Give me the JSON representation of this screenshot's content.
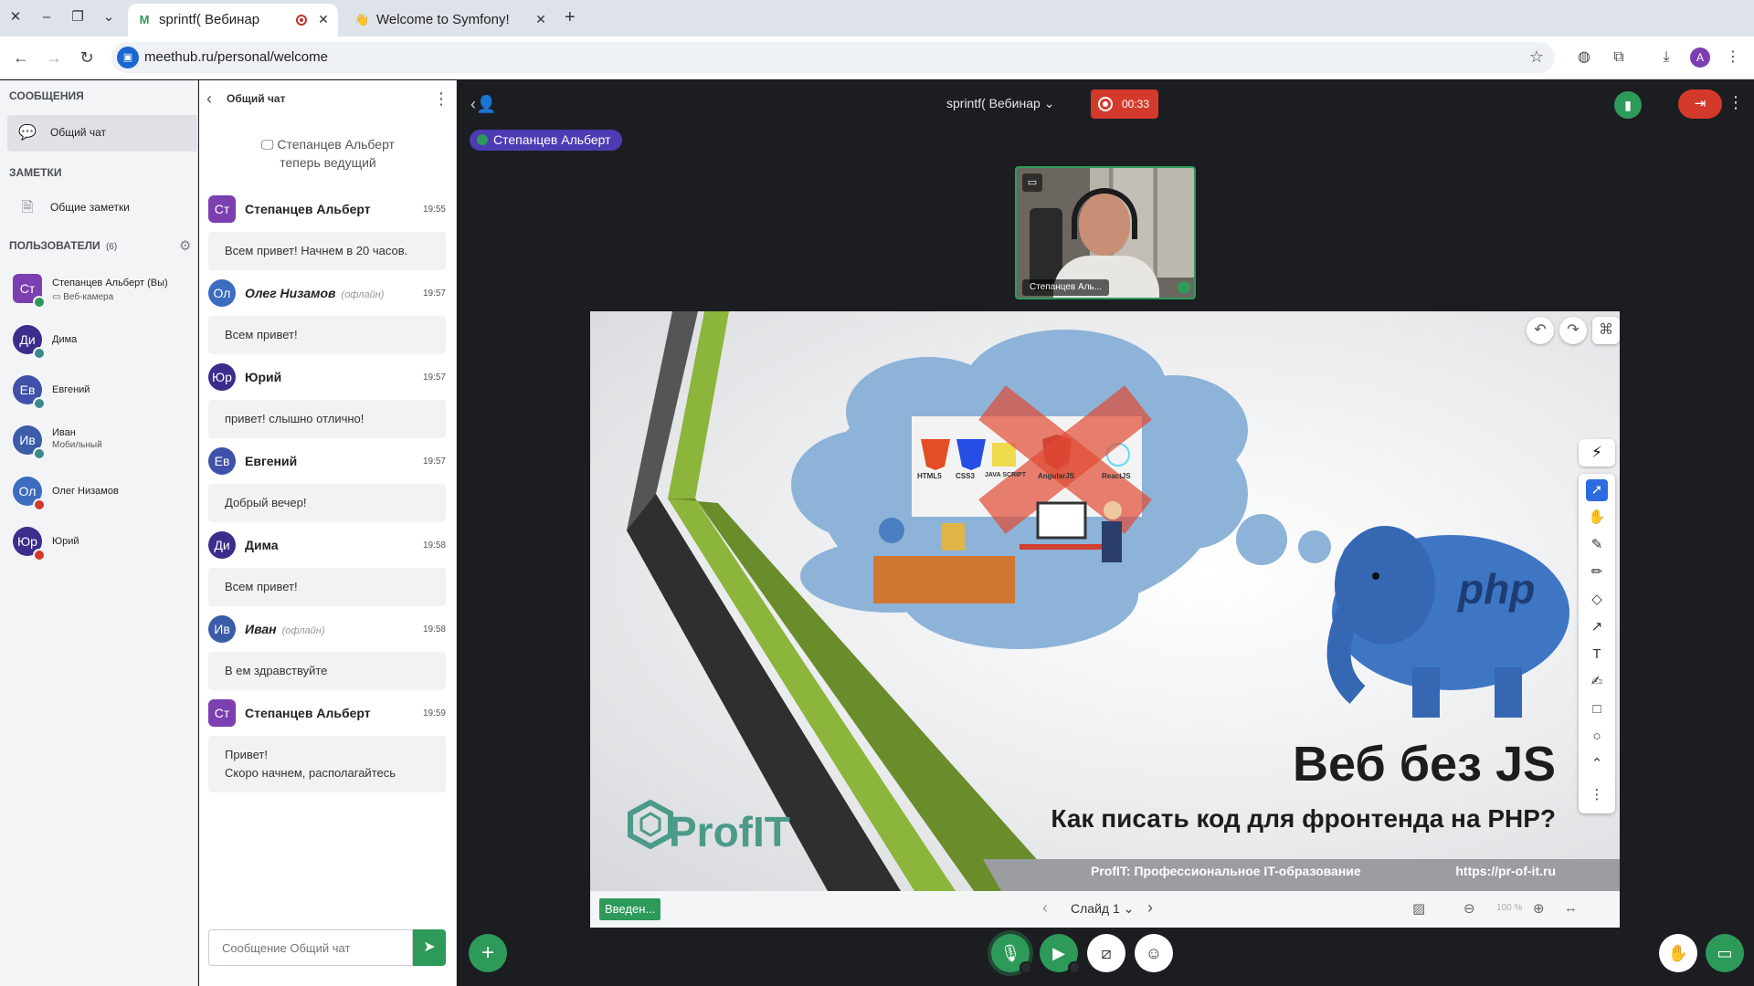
{
  "browser": {
    "tabs": [
      {
        "favicon": "M",
        "title": "sprintf( Вебинар"
      },
      {
        "favicon": "👋",
        "title": "Welcome to Symfony!"
      }
    ],
    "url": "meethub.ru/personal/welcome",
    "profile_initial": "A"
  },
  "sidebar": {
    "messages_title": "СООБЩЕНИЯ",
    "general_chat": "Общий чат",
    "notes_title": "ЗАМЕТКИ",
    "shared_notes": "Общие заметки",
    "users_title": "ПОЛЬЗОВАТЕЛИ",
    "users_count": "(6)",
    "users": [
      {
        "initials": "Ст",
        "name": "Степанцев Альберт (Вы)",
        "sub": "Веб-камера",
        "color": "#7b3fb0",
        "status": "#2e9a5a"
      },
      {
        "initials": "Ди",
        "name": "Дима",
        "sub": "",
        "color": "#3a2d8c",
        "status": "#3b8a8a"
      },
      {
        "initials": "Ев",
        "name": "Евгений",
        "sub": "",
        "color": "#3f51a8",
        "status": "#3b8a8a"
      },
      {
        "initials": "Ив",
        "name": "Иван",
        "sub": "Мобильный",
        "color": "#3b5ca8",
        "status": "#3b8a8a"
      },
      {
        "initials": "Ол",
        "name": "Олег Низамов",
        "sub": "",
        "color": "#3b6cbf",
        "status": "#d33a2c"
      },
      {
        "initials": "Юр",
        "name": "Юрий",
        "sub": "",
        "color": "#3a2d8c",
        "status": "#d33a2c"
      }
    ]
  },
  "chat": {
    "title": "Общий чат",
    "system_line1": "Степанцев Альберт",
    "system_line2": "теперь ведущий",
    "offline_label": "(офлайн)",
    "messages": [
      {
        "initials": "Ст",
        "name": "Степанцев Альберт",
        "time": "19:55",
        "text": "Всем привет! Начнем в 20 часов.",
        "color": "#7b3fb0"
      },
      {
        "initials": "Ол",
        "name": "Олег Низамов",
        "time": "19:57",
        "text": "Всем привет!",
        "color": "#3b6cbf"
      },
      {
        "initials": "Юр",
        "name": "Юрий",
        "time": "19:57",
        "text": "привет! слышно отлично!",
        "color": "#3a2d8c"
      },
      {
        "initials": "Ев",
        "name": "Евгений",
        "time": "19:57",
        "text": "Добрый вечер!",
        "color": "#3f51a8"
      },
      {
        "initials": "Ди",
        "name": "Дима",
        "time": "19:58",
        "text": "Всем привет!",
        "color": "#3a2d8c"
      },
      {
        "initials": "Ив",
        "name": "Иван",
        "time": "19:58",
        "text": "В ем здравствуйте",
        "color": "#3b5ca8"
      },
      {
        "initials": "Ст",
        "name": "Степанцев Альберт",
        "time": "19:59",
        "text": "Привет!\nСкоро начнем, располагайтесь",
        "color": "#7b3fb0"
      }
    ],
    "input_placeholder": "Сообщение Общий чат"
  },
  "stage": {
    "meeting_title": "sprintf( Вебинар",
    "record_time": "00:33",
    "presenter": "Степанцев Альберт",
    "camera_caption": "Степанцев Аль...",
    "slide": {
      "title": "Веб без JS",
      "subtitle": "Как писать код для фронтенда на PHP?",
      "footer_left": "ProfIT: Профессиональное IT-образование",
      "footer_right": "https://pr-of-it.ru",
      "brand": "ProfIT",
      "php_logo": "php",
      "tech_labels": [
        "HTML5",
        "CSS3",
        "JAVA SCRIPT",
        "AngularJS",
        "ReactJS"
      ]
    },
    "slide_name": "Введен...",
    "slide_number": "Слайд 1",
    "zoom": "100 %"
  },
  "colors": {
    "accent_green": "#2e9a5a",
    "record_red": "#d33a2c",
    "presenter_purple": "#4b3cb4",
    "stage_bg": "#1b1d21"
  }
}
